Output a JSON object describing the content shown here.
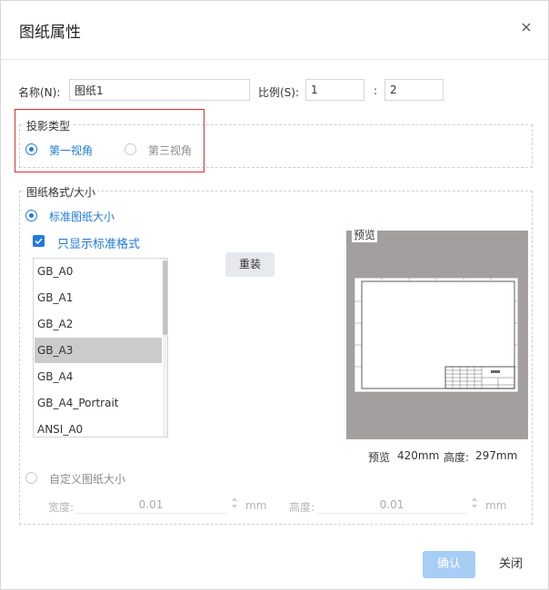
{
  "dialog": {
    "title": "图纸属性",
    "close_label": "×"
  },
  "name_row": {
    "name_label": "名称(N):",
    "name_value": "图纸1",
    "scale_label": "比例(S):",
    "scale_num": "1",
    "scale_sep": ":",
    "scale_den": "2"
  },
  "projection": {
    "legend": "投影类型",
    "options": [
      {
        "label": "第一视角",
        "checked": true
      },
      {
        "label": "第三视角",
        "checked": false
      }
    ]
  },
  "format": {
    "legend": "图纸格式/大小",
    "standard_label": "标准图纸大小",
    "standard_checked": true,
    "only_standard_label": "只显示标准格式",
    "only_standard_checked": true,
    "list": [
      "GB_A0",
      "GB_A1",
      "GB_A2",
      "GB_A3",
      "GB_A4",
      "GB_A4_Portrait",
      "ANSI_A0"
    ],
    "selected": "GB_A3",
    "reset_label": "重装",
    "preview_label": "预览",
    "preview_info": {
      "label": "预览",
      "width": "420mm",
      "height_label": "高度:",
      "height": "297mm"
    },
    "custom_label": "自定义图纸大小",
    "custom_checked": false,
    "width_label": "宽度:",
    "width_value": "0.01",
    "width_unit": "mm",
    "height_label": "高度:",
    "height_value": "0.01",
    "height_unit": "mm"
  },
  "footer": {
    "confirm_label": "确认",
    "close_label": "关闭"
  },
  "colors": {
    "accent": "#1e7be0",
    "confirm_disabled": "#a6cdf5",
    "highlight_border": "#d32f2f",
    "preview_bg": "#a49f9f"
  }
}
